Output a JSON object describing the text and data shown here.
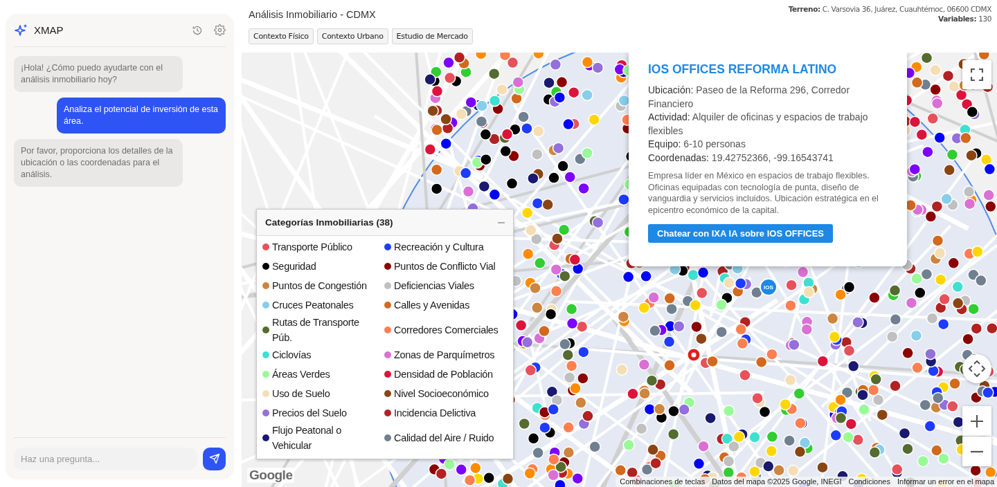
{
  "sidebar": {
    "title": "XMAP",
    "messages": [
      {
        "kind": "assistant",
        "text": "¡Hola! ¿Cómo puedo ayudarte con el análisis inmobiliario hoy?"
      },
      {
        "kind": "user",
        "text": "Analiza el potencial de inversión de esta área."
      },
      {
        "kind": "assistant",
        "text": "Por favor, proporciona los detalles de la ubicación o las coordenadas para el análisis."
      }
    ],
    "input": {
      "placeholder": "Haz una pregunta..."
    }
  },
  "header": {
    "title": "Análisis Inmobiliario - CDMX",
    "tabs": [
      "Contexto Físico",
      "Contexto Urbano",
      "Estudio de Mercado"
    ],
    "site_info": [
      "**Terreno:** C. Varsovia 36, Juárez, Cuauhtémoc, 06600 CDMX",
      "**Variables:** 130"
    ]
  },
  "map": {
    "legend": {
      "title": "Categorías Inmobiliarias (38)",
      "items": [
        {
          "label": "Transporte Público",
          "color": "#e8505b"
        },
        {
          "label": "Recreación y Cultura",
          "color": "#1e3cff"
        },
        {
          "label": "Seguridad",
          "color": "#000000"
        },
        {
          "label": "Puntos de Conflicto Vial",
          "color": "#8b0000"
        },
        {
          "label": "Puntos de Congestión",
          "color": "#cd853f"
        },
        {
          "label": "Deficiencias Viales",
          "color": "#c0c0c0"
        },
        {
          "label": "Cruces Peatonales",
          "color": "#87ceeb"
        },
        {
          "label": "Calles y Avenidas",
          "color": "#d2691e"
        },
        {
          "label": "Rutas de Transporte Púb.",
          "color": "#556b2f"
        },
        {
          "label": "Corredores Comerciales",
          "color": "#ff7f50"
        },
        {
          "label": "Ciclovías",
          "color": "#40e0d0"
        },
        {
          "label": "Zonas de Parquímetros",
          "color": "#da70d6"
        },
        {
          "label": "Áreas Verdes",
          "color": "#98fb98"
        },
        {
          "label": "Densidad de Población",
          "color": "#dc143c"
        },
        {
          "label": "Uso de Suelo",
          "color": "#f5deb3"
        },
        {
          "label": "Nivel Socioeconómico",
          "color": "#8b4513"
        },
        {
          "label": "Precios del Suelo",
          "color": "#9370db"
        },
        {
          "label": "Incidencia Delictiva",
          "color": "#b22222"
        },
        {
          "label": "Flujo Peatonal o Vehicular",
          "color": "#191970"
        },
        {
          "label": "Calidad del Aire / Ruido",
          "color": "#708090"
        }
      ]
    },
    "popup": {
      "title": "IOS OFFICES REFORMA LATINO",
      "fields": [
        "**Ubicación:** Paseo de la Reforma 296, Corredor Financiero",
        "**Actividad:** Alquiler de oficinas y espacios de trabajo flexibles",
        "**Equipo:** 6-10 personas",
        "**Coordenadas:** 19.42752366, -99.16543741"
      ],
      "description": "Empresa líder en México en espacios de trabajo flexibles. Oficinas equipadas con tecnología de punta, diseño de vanguardia y servicios incluidos. Ubicación estratégica en el epicentro económico de la capital.",
      "button": "Chatear con IXA IA sobre IOS OFFICES"
    },
    "marker_label": "IOS",
    "logo": "Google",
    "attribution": [
      "Combinaciones de teclas",
      "Datos del mapa ©2025 Google, INEGI",
      "Condiciones",
      "Informar un error en el mapa"
    ]
  }
}
